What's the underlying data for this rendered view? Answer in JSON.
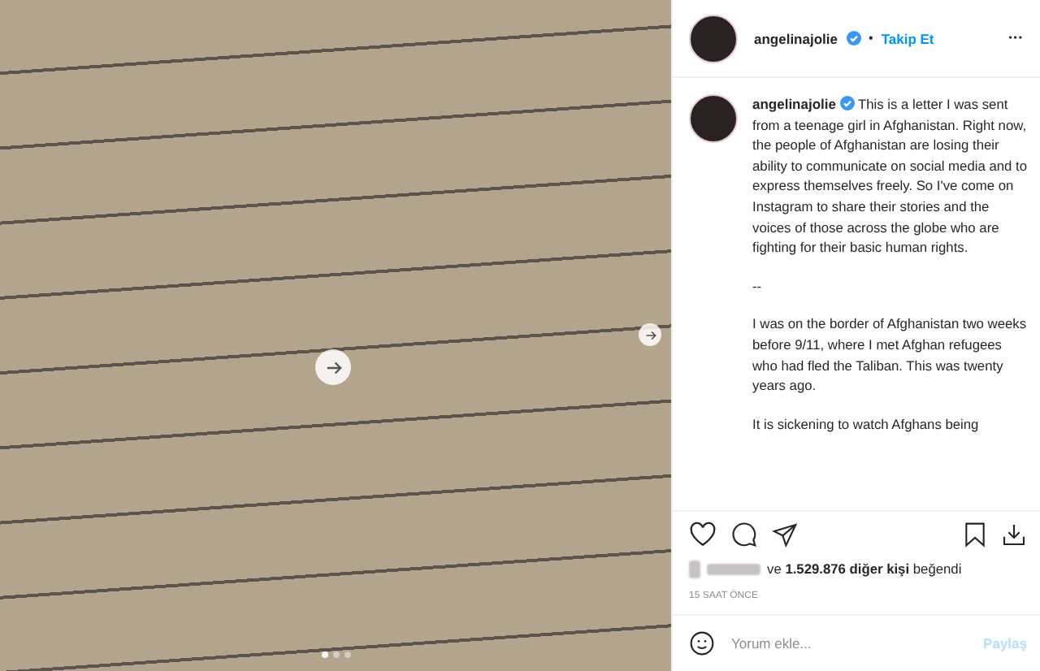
{
  "post": {
    "carousel": {
      "dots": [
        {
          "selected": true
        },
        {
          "selected": false
        },
        {
          "selected": false
        }
      ]
    }
  },
  "header": {
    "username": "angelinajolie",
    "verified": true,
    "separator": "•",
    "follow": "Takip Et",
    "more": "•••"
  },
  "caption": {
    "username": "angelinajolie",
    "verified": true,
    "paragraphs": [
      "This is a letter I was sent from a teenage girl in Afghanistan. Right now, the people of Afghanistan are losing their ability to communicate on social media and to express themselves freely. So I've come on Instagram to share their stories and the voices of those across the globe who are fighting for their basic human rights.",
      "--",
      "I was on the border of Afghanistan two weeks before 9/11, where I met Afghan refugees who had fled the Taliban. This was twenty years ago.",
      "It is sickening to watch Afghans being"
    ]
  },
  "likes": {
    "text": "ve **1.529.876 diğer kişi** beğendi"
  },
  "time": "15 SAAT ÖNCE",
  "comment": {
    "placeholder": "Yorum ekle...",
    "submit": "Paylaş"
  }
}
